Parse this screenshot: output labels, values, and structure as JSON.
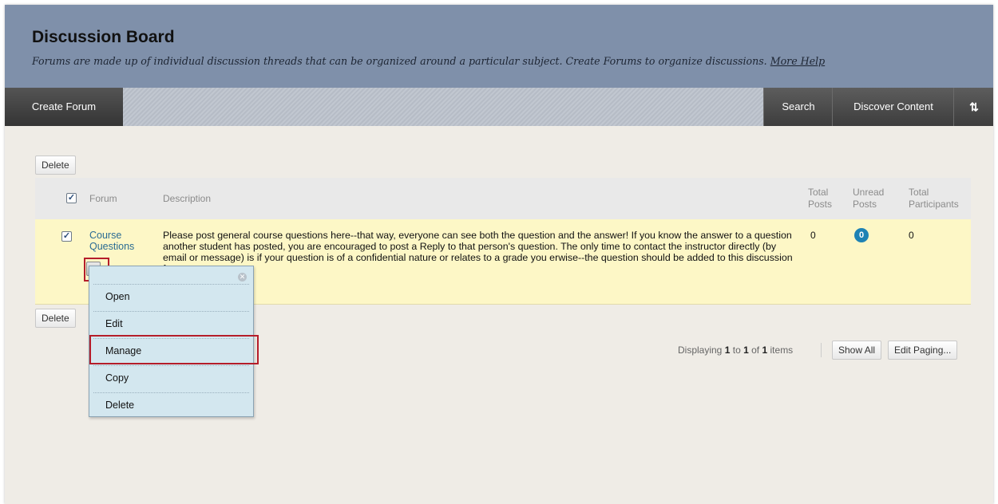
{
  "header": {
    "title": "Discussion Board",
    "subtitle": "Forums are made up of individual discussion threads that can be organized around a particular subject. Create Forums to organize discussions.",
    "more_help": "More Help"
  },
  "actionbar": {
    "create_forum": "Create Forum",
    "search": "Search",
    "discover_content": "Discover Content",
    "sort_icon": "⇅"
  },
  "buttons": {
    "delete": "Delete",
    "show_all": "Show All",
    "edit_paging": "Edit Paging..."
  },
  "table": {
    "columns": {
      "forum": "Forum",
      "description": "Description",
      "total_posts": "Total Posts",
      "unread_posts": "Unread Posts",
      "total_participants": "Total Participants"
    },
    "rows": [
      {
        "forum": "Course Questions",
        "description": "Please post general course questions here--that way, everyone can see both the question and the answer! If you know the answer to a question another student has posted, you are encouraged to post a Reply to that person's question. The only time to contact the instructor directly (by email or message) is if your question is of a confidential nature or relates to a grade you erwise--the question should be added to this discussion forum.",
        "total_posts": "0",
        "unread_posts": "0",
        "total_participants": "0"
      }
    ]
  },
  "context_menu": {
    "items": [
      "Open",
      "Edit",
      "Manage",
      "Copy",
      "Delete"
    ]
  },
  "paging": {
    "prefix": "Displaying",
    "from": "1",
    "to_word": "to",
    "to": "1",
    "of_word": "of",
    "total": "1",
    "suffix": "items"
  },
  "colors": {
    "header_bg": "#7f90aa",
    "row_highlight": "#fdf7c6",
    "link": "#2a6b93",
    "badge": "#1e82b4",
    "menu_bg": "#d3e7ef",
    "callout_red": "#b51d2a"
  }
}
